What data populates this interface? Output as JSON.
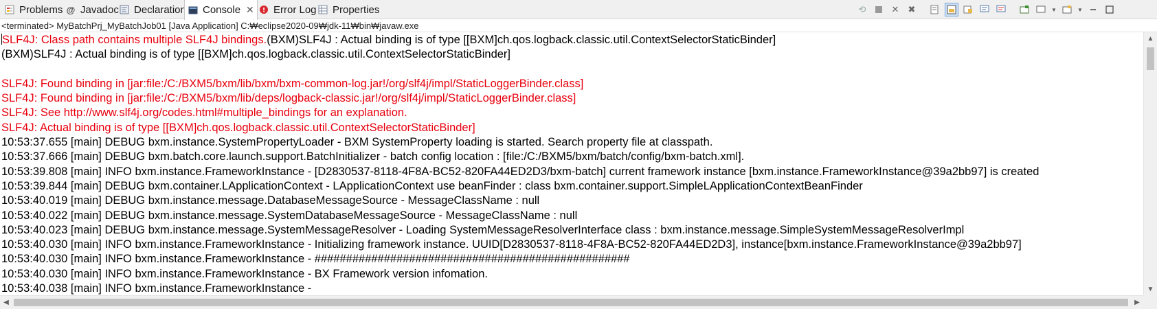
{
  "tabs": [
    {
      "label": "Problems",
      "icon": "problems-icon"
    },
    {
      "label": "Javadoc",
      "icon": "javadoc-icon"
    },
    {
      "label": "Declaration",
      "icon": "declaration-icon"
    },
    {
      "label": "Console",
      "icon": "console-icon",
      "active": true
    },
    {
      "label": "Error Log",
      "icon": "error-log-icon"
    },
    {
      "label": "Properties",
      "icon": "properties-icon"
    }
  ],
  "toolbar_icons": [
    "terminate-relaunch-icon",
    "stop-icon",
    "remove-launch-icon",
    "remove-all-terminated-icon",
    "clear-console-icon",
    "scroll-lock-icon",
    "word-wrap-icon",
    "show-on-stdout-icon",
    "show-on-stderr-icon",
    "pin-console-icon",
    "display-console-icon",
    "open-console-icon",
    "minimize-icon",
    "maximize-icon"
  ],
  "process_label": "<terminated> MyBatchPrj_MyBatchJob01 [Java Application] C:₩eclipse2020-09₩jdk-11₩bin₩javaw.exe",
  "console": {
    "colors": {
      "stderr": "#e8000d",
      "stdout": "#000000"
    },
    "lines": [
      {
        "segments": [
          {
            "text": "SLF4J: Class path contains multiple SLF4J bindings.",
            "stream": "err"
          },
          {
            "text": "(BXM)SLF4J : Actual binding is of type [[BXM]ch.qos.logback.classic.util.ContextSelectorStaticBinder]",
            "stream": "out"
          }
        ]
      },
      {
        "segments": [
          {
            "text": "(BXM)SLF4J : Actual binding is of type [[BXM]ch.qos.logback.classic.util.ContextSelectorStaticBinder]",
            "stream": "out"
          }
        ]
      },
      {
        "segments": [
          {
            "text": "",
            "stream": "out"
          }
        ]
      },
      {
        "segments": [
          {
            "text": "SLF4J: Found binding in [jar:file:/C:/BXM5/bxm/lib/bxm/bxm-common-log.jar!/org/slf4j/impl/StaticLoggerBinder.class]",
            "stream": "err"
          }
        ]
      },
      {
        "segments": [
          {
            "text": "SLF4J: Found binding in [jar:file:/C:/BXM5/bxm/lib/deps/logback-classic.jar!/org/slf4j/impl/StaticLoggerBinder.class]",
            "stream": "err"
          }
        ]
      },
      {
        "segments": [
          {
            "text": "SLF4J: See http://www.slf4j.org/codes.html#multiple_bindings for an explanation.",
            "stream": "err"
          }
        ]
      },
      {
        "segments": [
          {
            "text": "SLF4J: Actual binding is of type [[BXM]ch.qos.logback.classic.util.ContextSelectorStaticBinder]",
            "stream": "err"
          }
        ]
      },
      {
        "segments": [
          {
            "text": "10:53:37.655 [main] DEBUG bxm.instance.SystemPropertyLoader - BXM SystemProperty loading is started. Search property file at classpath.",
            "stream": "out"
          }
        ]
      },
      {
        "segments": [
          {
            "text": "10:53:37.666 [main] DEBUG bxm.batch.core.launch.support.BatchInitializer - batch config location : [file:/C:/BXM5/bxm/batch/config/bxm-batch.xml].",
            "stream": "out"
          }
        ]
      },
      {
        "segments": [
          {
            "text": "10:53:39.808 [main] INFO bxm.instance.FrameworkInstance - [D2830537-8118-4F8A-BC52-820FA44ED2D3/bxm-batch] current framework instance [bxm.instance.FrameworkInstance@39a2bb97] is created",
            "stream": "out"
          }
        ]
      },
      {
        "segments": [
          {
            "text": "10:53:39.844 [main] DEBUG bxm.container.LApplicationContext - LApplicationContext use beanFinder : class bxm.container.support.SimpleLApplicationContextBeanFinder",
            "stream": "out"
          }
        ]
      },
      {
        "segments": [
          {
            "text": "10:53:40.019 [main] DEBUG bxm.instance.message.DatabaseMessageSource - MessageClassName : null",
            "stream": "out"
          }
        ]
      },
      {
        "segments": [
          {
            "text": "10:53:40.022 [main] DEBUG bxm.instance.message.SystemDatabaseMessageSource - MessageClassName : null",
            "stream": "out"
          }
        ]
      },
      {
        "segments": [
          {
            "text": "10:53:40.023 [main] DEBUG bxm.instance.message.SystemMessageResolver - Loading SystemMessageResolverInterface class : bxm.instance.message.SimpleSystemMessageResolverImpl",
            "stream": "out"
          }
        ]
      },
      {
        "segments": [
          {
            "text": "10:53:40.030 [main] INFO bxm.instance.FrameworkInstance - Initializing framework instance. UUID[D2830537-8118-4F8A-BC52-820FA44ED2D3], instance[bxm.instance.FrameworkInstance@39a2bb97]",
            "stream": "out"
          }
        ]
      },
      {
        "segments": [
          {
            "text": "10:53:40.030 [main] INFO bxm.instance.FrameworkInstance - ##################################################",
            "stream": "out"
          }
        ]
      },
      {
        "segments": [
          {
            "text": "10:53:40.030 [main] INFO bxm.instance.FrameworkInstance - BX Framework version infomation.",
            "stream": "out"
          }
        ]
      },
      {
        "segments": [
          {
            "text": "10:53:40.038 [main] INFO bxm.instance.FrameworkInstance - ",
            "stream": "out"
          }
        ]
      }
    ]
  }
}
